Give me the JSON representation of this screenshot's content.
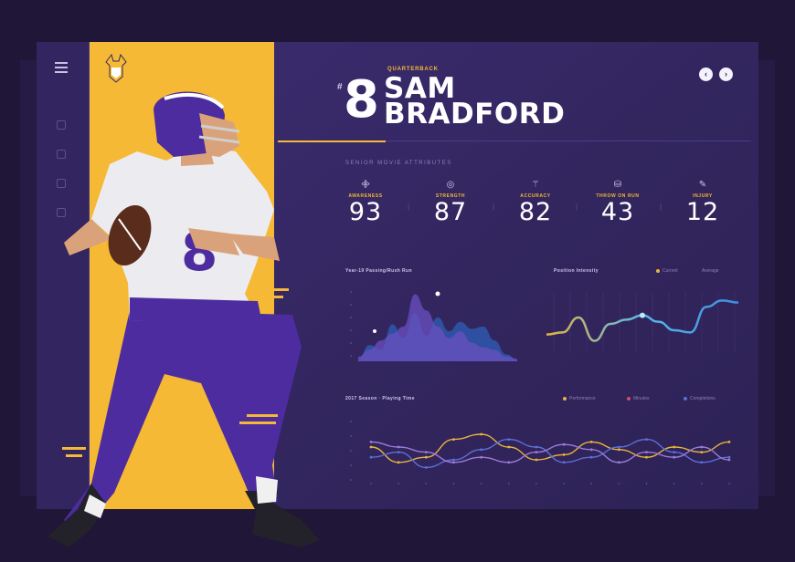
{
  "player": {
    "position": "QUARTERBACK",
    "number": "8",
    "first_name": "SAM",
    "last_name": "BRADFORD",
    "jersey_number": "8"
  },
  "header_buttons": [
    "‹",
    "›"
  ],
  "stats_section_title": "SENIOR MOVIE ATTRIBUTES",
  "stats": [
    {
      "icon": "wifi-icon",
      "glyph": "᯽",
      "label": "AWARENESS",
      "value": "93"
    },
    {
      "icon": "target-icon",
      "glyph": "◎",
      "label": "STRENGTH",
      "value": "87"
    },
    {
      "icon": "signal-icon",
      "glyph": "⚚",
      "label": "ACCURACY",
      "value": "82"
    },
    {
      "icon": "flame-icon",
      "glyph": "⛁",
      "label": "THROW ON RUN",
      "value": "43"
    },
    {
      "icon": "bandage-icon",
      "glyph": "✎",
      "label": "INJURY",
      "value": "12"
    }
  ],
  "charts": {
    "area": {
      "title": "Year-19 Passing/Rush Run"
    },
    "line": {
      "title": "Position Intensity",
      "legend": [
        "Current",
        "Average"
      ]
    },
    "multi": {
      "title": "2017 Season · Playing Time",
      "legend": [
        "Performance",
        "Minutes",
        "Completions"
      ]
    }
  },
  "colors": {
    "accent": "#f5b935",
    "background": "#33265f",
    "series_yellow": "#e8b43c",
    "series_blue": "#5b6fd6",
    "series_purple": "#9b7bd8"
  },
  "chart_data": [
    {
      "type": "area",
      "title": "Year-19 Passing/Rush Run",
      "x": [
        0,
        1,
        2,
        3,
        4,
        5,
        6,
        7,
        8,
        9,
        10,
        11,
        12,
        13,
        14
      ],
      "series": [
        {
          "values": [
            2,
            14,
            10,
            32,
            20,
            42,
            22,
            38,
            26,
            34,
            28,
            30,
            18,
            6,
            2
          ]
        },
        {
          "values": [
            4,
            10,
            18,
            24,
            30,
            58,
            44,
            30,
            20,
            26,
            16,
            12,
            10,
            4,
            2
          ]
        }
      ],
      "ylim": [
        0,
        60
      ]
    },
    {
      "type": "line",
      "title": "Position Intensity",
      "x": [
        0,
        1,
        2,
        3,
        4,
        5,
        6,
        7,
        8,
        9,
        10,
        11,
        12
      ],
      "series": [
        {
          "name": "Current",
          "values": [
            20,
            22,
            36,
            14,
            30,
            34,
            38,
            32,
            24,
            22,
            46,
            52,
            50
          ]
        }
      ],
      "ylim": [
        0,
        60
      ]
    },
    {
      "type": "line",
      "title": "2017 Season · Playing Time",
      "x": [
        0,
        1,
        2,
        3,
        4,
        5,
        6,
        7,
        8,
        9,
        10,
        11,
        12,
        13
      ],
      "series": [
        {
          "name": "Performance",
          "values": [
            30,
            18,
            22,
            36,
            40,
            30,
            20,
            24,
            34,
            28,
            22,
            30,
            26,
            34
          ]
        },
        {
          "name": "Minutes",
          "values": [
            22,
            26,
            14,
            20,
            28,
            36,
            30,
            18,
            22,
            30,
            36,
            26,
            18,
            22
          ]
        },
        {
          "name": "Completions",
          "values": [
            34,
            30,
            26,
            18,
            22,
            18,
            26,
            32,
            28,
            18,
            26,
            22,
            30,
            20
          ]
        }
      ],
      "ylim": [
        0,
        50
      ]
    }
  ]
}
